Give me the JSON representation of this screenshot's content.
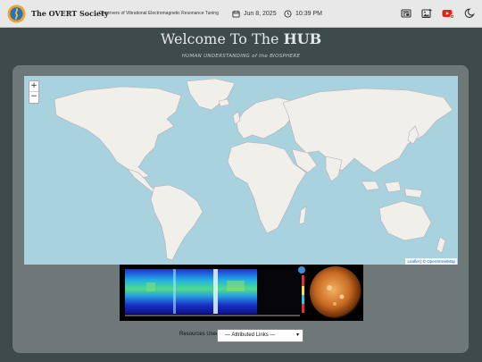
{
  "header": {
    "brand": "The OVERT Society",
    "tagline": "Observers of Vibrational Electromagnetic Resonance Tuning",
    "date": "Jun 8, 2025",
    "time": "10:39 PM",
    "icons": [
      "calendar-icon",
      "clock-icon",
      "newspaper-icon",
      "gallery-icon",
      "youtube-icon",
      "moon-icon"
    ]
  },
  "hero": {
    "title_prefix": "Welcome To The ",
    "title_strong": "HUB",
    "subtitle": "HUMAN UNDERSTANDING of the BIOSPHERE"
  },
  "map": {
    "zoom_in": "+",
    "zoom_out": "−",
    "attr_leaflet": "Leaflet",
    "attr_sep": " | © ",
    "attr_osm": "OpenStreetMap"
  },
  "resources": {
    "label": "Resources Used:",
    "selected": "— Attributed Links —"
  },
  "colors": {
    "background": "#3f4a4c",
    "panel": "#6e7878",
    "ocean": "#a9d2df",
    "land": "#f1efe9"
  }
}
